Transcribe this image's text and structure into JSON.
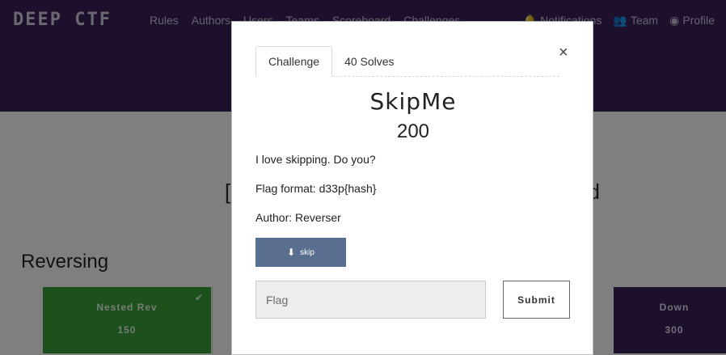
{
  "navbar": {
    "logo": "DEEP CTF",
    "links": [
      "Rules",
      "Authors",
      "Users",
      "Teams",
      "Scoreboard",
      "Challenges"
    ],
    "notifications_label": "Notifications",
    "team_label": "Team",
    "profile_label": "Profile"
  },
  "page": {
    "section_title": "Reversing",
    "cards": [
      {
        "name": "Nested Rev",
        "value": "150",
        "solved": true
      },
      {
        "name": "Down",
        "value": "300",
        "solved": false
      }
    ]
  },
  "modal": {
    "tabs": [
      "Challenge",
      "40 Solves"
    ],
    "close_symbol": "×",
    "challenge_name": "SkipMe",
    "challenge_value": "200",
    "description": [
      "I love skipping. Do you?",
      "Flag format: d33p{hash}",
      "Author: Reverser"
    ],
    "file_label": "skip",
    "flag_placeholder": "Flag",
    "submit_label": "Submit"
  },
  "colors": {
    "navbar": "#3a2158",
    "solved_card": "#39a23a",
    "file_button": "#5a6f8f"
  },
  "icons": {
    "notifications": "bell-icon",
    "team": "users-icon",
    "profile": "user-circle-icon",
    "file": "download-icon",
    "solved": "check-icon"
  }
}
